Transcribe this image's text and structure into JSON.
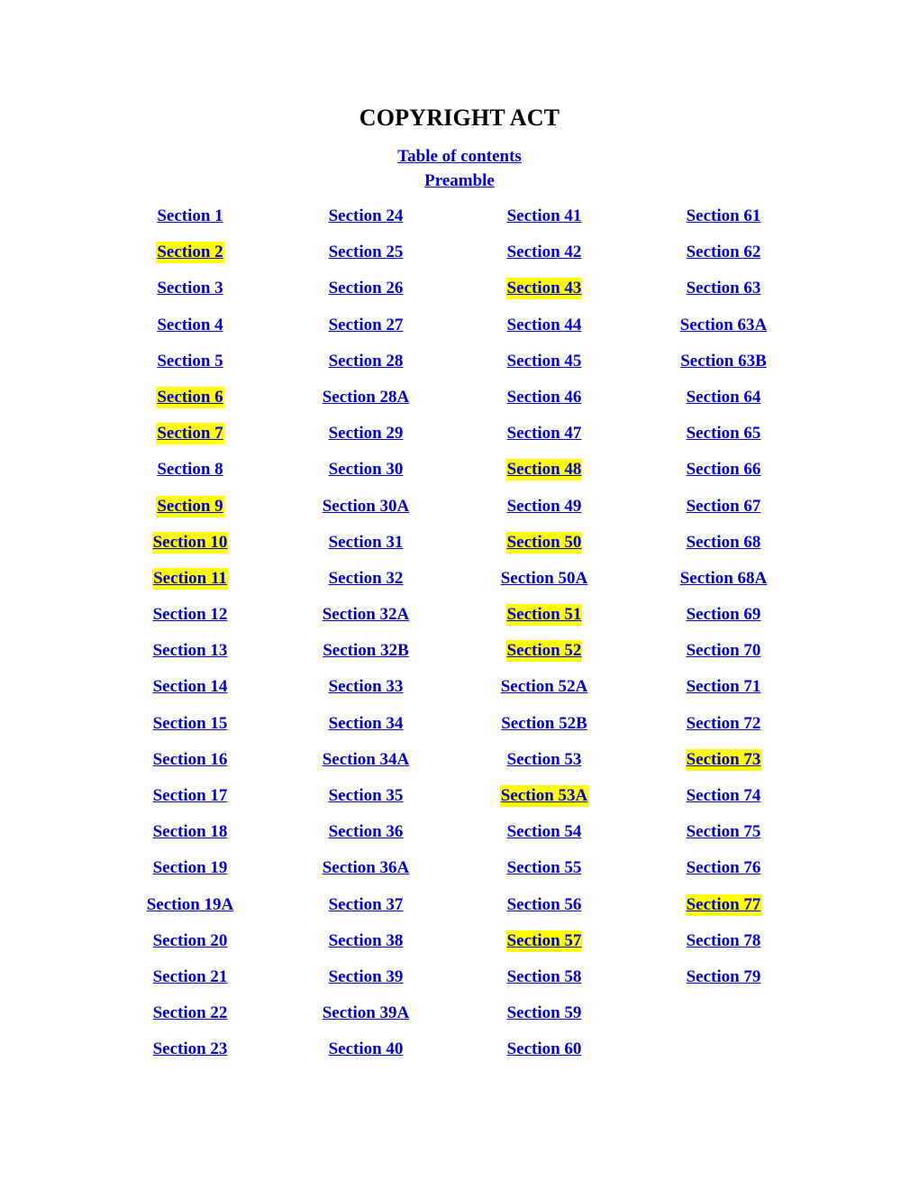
{
  "document": {
    "title": "COPYRIGHT ACT",
    "header_links": [
      {
        "label": "Table of contents",
        "name": "table-of-contents-link"
      },
      {
        "label": "Preamble",
        "name": "preamble-link"
      }
    ]
  },
  "colors": {
    "link": "#0000CC",
    "highlight": "#FFFF00",
    "title": "#000000",
    "background": "#FFFFFF"
  },
  "toc": {
    "columns": [
      {
        "index": 1,
        "items": [
          {
            "label": "Section 1",
            "highlighted": false
          },
          {
            "label": "Section 2",
            "highlighted": true
          },
          {
            "label": "Section 3",
            "highlighted": false
          },
          {
            "label": "Section 4",
            "highlighted": false
          },
          {
            "label": "Section 5",
            "highlighted": false
          },
          {
            "label": "Section 6",
            "highlighted": true
          },
          {
            "label": "Section 7",
            "highlighted": true
          },
          {
            "label": "Section 8",
            "highlighted": false
          },
          {
            "label": "Section 9",
            "highlighted": true
          },
          {
            "label": "Section 10",
            "highlighted": true
          },
          {
            "label": "Section 11",
            "highlighted": true
          },
          {
            "label": "Section 12",
            "highlighted": false
          },
          {
            "label": "Section 13",
            "highlighted": false
          },
          {
            "label": "Section 14",
            "highlighted": false
          },
          {
            "label": "Section 15",
            "highlighted": false
          },
          {
            "label": "Section 16",
            "highlighted": false
          },
          {
            "label": "Section 17",
            "highlighted": false
          },
          {
            "label": "Section 18",
            "highlighted": false
          },
          {
            "label": "Section 19",
            "highlighted": false
          },
          {
            "label": "Section 19A",
            "highlighted": false
          },
          {
            "label": "Section 20",
            "highlighted": false
          },
          {
            "label": "Section 21",
            "highlighted": false
          },
          {
            "label": "Section 22",
            "highlighted": false
          },
          {
            "label": "Section 23",
            "highlighted": false
          }
        ]
      },
      {
        "index": 2,
        "items": [
          {
            "label": "Section 24",
            "highlighted": false
          },
          {
            "label": "Section 25",
            "highlighted": false
          },
          {
            "label": "Section 26",
            "highlighted": false
          },
          {
            "label": "Section 27",
            "highlighted": false
          },
          {
            "label": "Section 28",
            "highlighted": false
          },
          {
            "label": "Section 28A",
            "highlighted": false
          },
          {
            "label": "Section 29",
            "highlighted": false
          },
          {
            "label": "Section 30",
            "highlighted": false
          },
          {
            "label": "Section 30A",
            "highlighted": false
          },
          {
            "label": "Section 31",
            "highlighted": false
          },
          {
            "label": "Section 32",
            "highlighted": false
          },
          {
            "label": "Section 32A",
            "highlighted": false
          },
          {
            "label": "Section 32B",
            "highlighted": false
          },
          {
            "label": "Section 33",
            "highlighted": false
          },
          {
            "label": "Section 34",
            "highlighted": false
          },
          {
            "label": "Section 34A",
            "highlighted": false
          },
          {
            "label": "Section 35",
            "highlighted": false
          },
          {
            "label": "Section 36",
            "highlighted": false
          },
          {
            "label": "Section 36A",
            "highlighted": false
          },
          {
            "label": "Section 37",
            "highlighted": false
          },
          {
            "label": "Section 38",
            "highlighted": false
          },
          {
            "label": "Section 39",
            "highlighted": false
          },
          {
            "label": "Section 39A",
            "highlighted": false
          },
          {
            "label": "Section 40",
            "highlighted": false
          }
        ]
      },
      {
        "index": 3,
        "items": [
          {
            "label": "Section 41",
            "highlighted": false
          },
          {
            "label": "Section 42",
            "highlighted": false
          },
          {
            "label": "Section 43",
            "highlighted": true
          },
          {
            "label": "Section 44",
            "highlighted": false
          },
          {
            "label": "Section 45",
            "highlighted": false
          },
          {
            "label": "Section 46",
            "highlighted": false
          },
          {
            "label": "Section 47",
            "highlighted": false
          },
          {
            "label": "Section 48",
            "highlighted": true
          },
          {
            "label": "Section 49",
            "highlighted": false
          },
          {
            "label": "Section 50",
            "highlighted": true
          },
          {
            "label": "Section 50A",
            "highlighted": false
          },
          {
            "label": "Section 51",
            "highlighted": true
          },
          {
            "label": "Section 52",
            "highlighted": true
          },
          {
            "label": "Section 52A",
            "highlighted": false
          },
          {
            "label": "Section 52B",
            "highlighted": false
          },
          {
            "label": "Section 53",
            "highlighted": false
          },
          {
            "label": "Section 53A",
            "highlighted": true
          },
          {
            "label": "Section 54",
            "highlighted": false
          },
          {
            "label": "Section 55",
            "highlighted": false
          },
          {
            "label": "Section 56",
            "highlighted": false
          },
          {
            "label": "Section 57",
            "highlighted": true
          },
          {
            "label": "Section 58",
            "highlighted": false
          },
          {
            "label": "Section 59",
            "highlighted": false
          },
          {
            "label": "Section 60",
            "highlighted": false
          }
        ]
      },
      {
        "index": 4,
        "items": [
          {
            "label": "Section 61",
            "highlighted": false
          },
          {
            "label": "Section 62",
            "highlighted": false
          },
          {
            "label": "Section 63",
            "highlighted": false
          },
          {
            "label": "Section 63A",
            "highlighted": false
          },
          {
            "label": "Section 63B",
            "highlighted": false
          },
          {
            "label": "Section 64",
            "highlighted": false
          },
          {
            "label": "Section 65",
            "highlighted": false
          },
          {
            "label": "Section 66",
            "highlighted": false
          },
          {
            "label": "Section 67",
            "highlighted": false
          },
          {
            "label": "Section 68",
            "highlighted": false
          },
          {
            "label": "Section 68A",
            "highlighted": false
          },
          {
            "label": "Section 69",
            "highlighted": false
          },
          {
            "label": "Section 70",
            "highlighted": false
          },
          {
            "label": "Section 71",
            "highlighted": false
          },
          {
            "label": "Section 72",
            "highlighted": false
          },
          {
            "label": "Section 73",
            "highlighted": true
          },
          {
            "label": "Section 74",
            "highlighted": false
          },
          {
            "label": "Section 75",
            "highlighted": false
          },
          {
            "label": "Section 76",
            "highlighted": false
          },
          {
            "label": "Section 77",
            "highlighted": true
          },
          {
            "label": "Section 78",
            "highlighted": false
          },
          {
            "label": "Section 79",
            "highlighted": false
          }
        ]
      }
    ]
  }
}
